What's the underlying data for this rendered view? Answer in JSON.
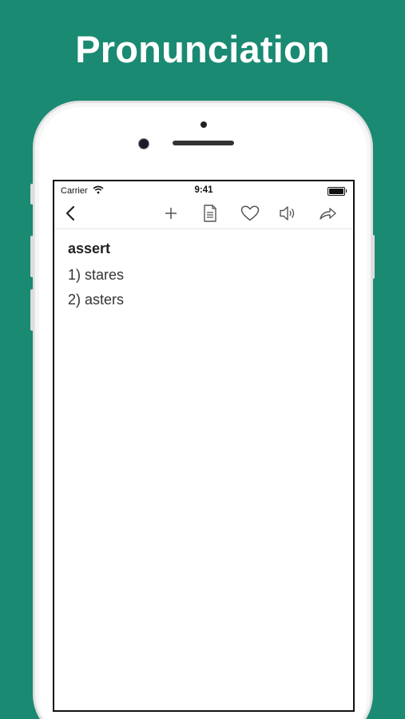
{
  "headline": "Pronunciation",
  "status_bar": {
    "carrier": "Carrier",
    "time": "9:41"
  },
  "toolbar": {
    "icons": [
      "back-chevron-icon",
      "plus-icon",
      "document-icon",
      "heart-icon",
      "speaker-icon",
      "share-icon"
    ]
  },
  "entry": {
    "word": "assert",
    "results": [
      "1) stares",
      "2) asters"
    ]
  },
  "colors": {
    "background": "#1a8a72",
    "headline_text": "#ffffff",
    "screen_background": "#ffffff",
    "toolbar_icon": "#555555"
  }
}
